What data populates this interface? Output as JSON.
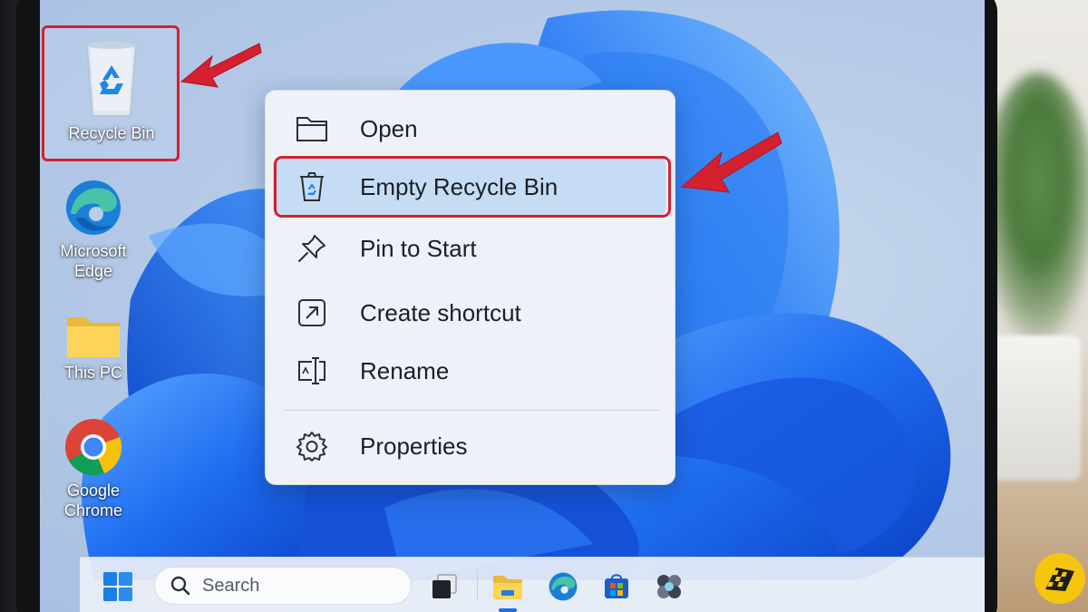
{
  "desktop": {
    "icons": [
      {
        "label": "Recycle Bin",
        "icon": "recycle-bin-icon"
      },
      {
        "label": "Microsoft Edge",
        "icon": "edge-icon"
      },
      {
        "label": "This PC",
        "icon": "folder-icon"
      },
      {
        "label": "Google Chrome",
        "icon": "chrome-icon"
      }
    ]
  },
  "context_menu": {
    "items": [
      {
        "label": "Open",
        "icon": "folder-icon"
      },
      {
        "label": "Empty Recycle Bin",
        "icon": "recycle-bin-icon",
        "highlighted": true
      },
      {
        "label": "Pin to Start",
        "icon": "pin-icon"
      },
      {
        "label": "Create shortcut",
        "icon": "shortcut-arrow-icon"
      },
      {
        "label": "Rename",
        "icon": "rename-icon"
      },
      {
        "label": "Properties",
        "icon": "gear-icon"
      }
    ]
  },
  "taskbar": {
    "search_placeholder": "Search",
    "apps": [
      "task-view-icon",
      "file-explorer-icon",
      "edge-icon",
      "store-icon",
      "copilot-icon"
    ]
  },
  "annotations": {
    "highlight_color": "#d5202f"
  },
  "colors": {
    "accent": "#1f6fe0",
    "menu_highlight": "#c6dcf5"
  }
}
